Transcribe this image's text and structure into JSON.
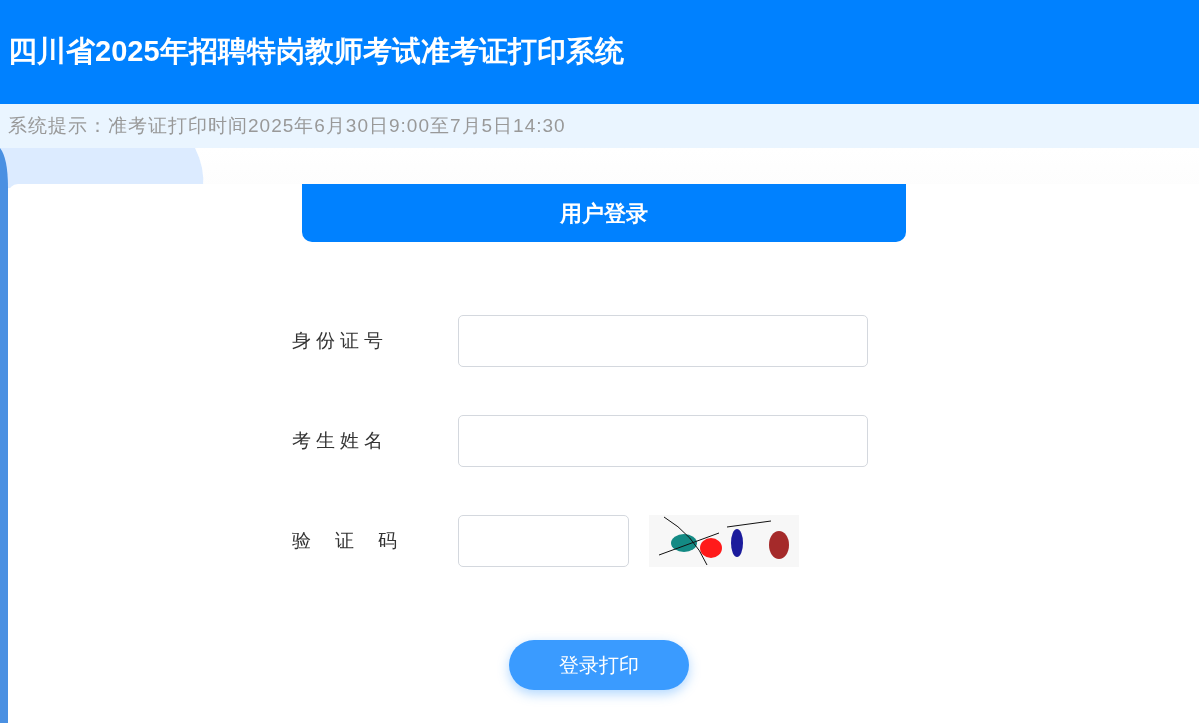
{
  "header": {
    "title": "四川省2025年招聘特岗教师考试准考证打印系统"
  },
  "notice": {
    "text": "系统提示：准考证打印时间2025年6月30日9:00至7月5日14:30"
  },
  "login": {
    "tab": "用户登录",
    "fields": [
      {
        "kind": "text",
        "label": "身 份 证 号"
      },
      {
        "kind": "text",
        "label": "考 生 姓 名"
      },
      {
        "kind": "captcha",
        "label": "验　 证　 码"
      }
    ],
    "button": "登录打印"
  }
}
